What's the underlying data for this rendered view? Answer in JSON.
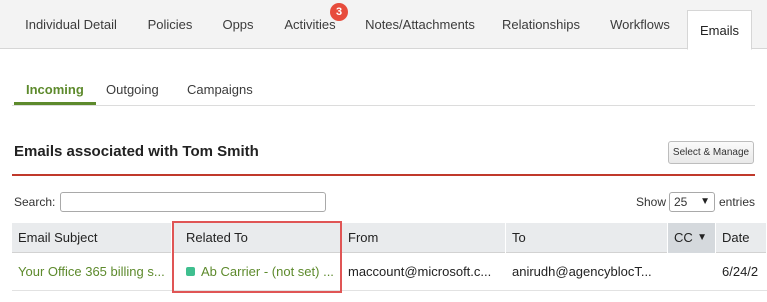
{
  "top_tabs": [
    {
      "label": "Individual Detail"
    },
    {
      "label": "Policies"
    },
    {
      "label": "Opps"
    },
    {
      "label": "Activities",
      "badge": "3"
    },
    {
      "label": "Notes/Attachments"
    },
    {
      "label": "Relationships"
    },
    {
      "label": "Workflows"
    },
    {
      "label": "Emails",
      "active": true
    }
  ],
  "sub_tabs": [
    {
      "label": "Incoming",
      "active": true
    },
    {
      "label": "Outgoing"
    },
    {
      "label": "Campaigns"
    }
  ],
  "section": {
    "title": "Emails associated with Tom Smith",
    "manage_button": "Select & Manage"
  },
  "controls": {
    "search_label": "Search:",
    "search_value": "",
    "show_label": "Show",
    "show_value": "25",
    "entries_label": "entries"
  },
  "table": {
    "columns": [
      "Email Subject",
      "Related To",
      "From",
      "To",
      "CC",
      "Date"
    ],
    "sorted_column": "CC",
    "rows": [
      {
        "subject": "Your Office 365 billing s...",
        "related_to": "Ab Carrier - (not set) ...",
        "from": "maccount@microsoft.c...",
        "to": "anirudh@agencyblocT...",
        "cc": "",
        "date": "6/24/2"
      }
    ]
  },
  "colors": {
    "accent_green": "#5d8a2c",
    "rule_red": "#c0392b",
    "badge_red": "#e74c3c",
    "related_square": "#3fbf8f",
    "highlight_red": "#e05555"
  }
}
